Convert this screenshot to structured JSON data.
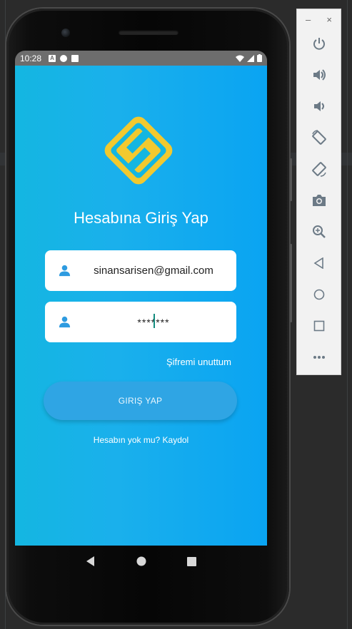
{
  "status_bar": {
    "time": "10:28",
    "icons": [
      "a-notification-icon",
      "sync-icon",
      "sd-card-icon",
      "wifi-icon",
      "signal-icon",
      "battery-icon"
    ]
  },
  "app": {
    "title": "Hesabına Giriş Yap",
    "email_value": "sinansarisen@gmail.com",
    "password_value": "*******",
    "forgot_label": "Şifremi unuttum",
    "login_label": "GIRIŞ YAP",
    "signup_label": "Hesabın yok mu? Kaydol"
  },
  "colors": {
    "background_start": "#14b6e1",
    "background_end": "#0aa4f2",
    "login_button": "#2fa5e4",
    "logo_yellow": "#f2c92f",
    "icon_blue": "#2e9be0"
  },
  "emulator_toolbar": {
    "minimize_label": "–",
    "close_label": "×",
    "items": [
      "power-icon",
      "volume-up-icon",
      "volume-down-icon",
      "rotate-left-icon",
      "rotate-right-icon",
      "camera-icon",
      "zoom-icon",
      "back-icon",
      "home-icon",
      "overview-icon",
      "more-icon"
    ]
  }
}
